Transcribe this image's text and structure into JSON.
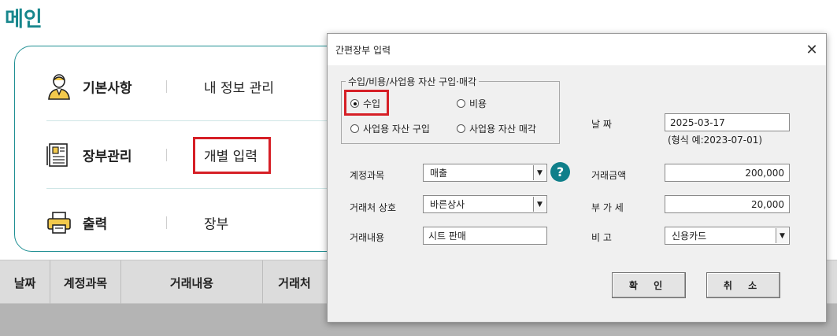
{
  "page": {
    "title": "메인"
  },
  "menu": {
    "rows": [
      {
        "label": "기본사항",
        "value": "내 정보 관리",
        "icon": "person-icon"
      },
      {
        "label": "장부관리",
        "value": "개별 입력",
        "icon": "ledger-icon"
      },
      {
        "label": "출력",
        "value": "장부",
        "icon": "printer-icon"
      }
    ]
  },
  "table": {
    "headers": [
      "날짜",
      "계정과목",
      "거래내용",
      "거래처"
    ]
  },
  "dialog": {
    "title": "간편장부 입력",
    "close_icon": "close-icon",
    "group": {
      "legend": "수입/비용/사업용 자산 구입·매각",
      "options": [
        {
          "label": "수입",
          "selected": true
        },
        {
          "label": "비용",
          "selected": false
        },
        {
          "label": "사업용 자산 구입",
          "selected": false
        },
        {
          "label": "사업용 자산 매각",
          "selected": false
        }
      ]
    },
    "date": {
      "label": "날    짜",
      "value": "2025-03-17",
      "hint": "(형식 예:2023-07-01)"
    },
    "account": {
      "label": "계정과목",
      "value": "매출"
    },
    "client": {
      "label": "거래처 상호",
      "value": "바른상사"
    },
    "content": {
      "label": "거래내용",
      "value": "시트 판매"
    },
    "amount": {
      "label": "거래금액",
      "value": "200,000"
    },
    "vat": {
      "label": "부 가 세",
      "value": "20,000"
    },
    "note": {
      "label": "비    고",
      "value": "신용카드"
    },
    "help_symbol": "?",
    "ok_label": "확 인",
    "cancel_label": "취 소"
  },
  "colors": {
    "accent": "#17868c",
    "highlight": "#d61f26",
    "help": "#0f7f8a"
  }
}
